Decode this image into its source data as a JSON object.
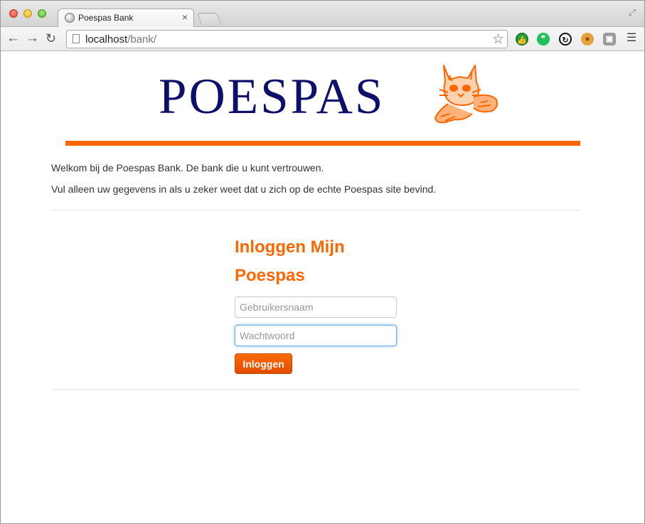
{
  "browser": {
    "tab": {
      "title": "Poespas Bank",
      "close_glyph": "×"
    },
    "url": {
      "host": "localhost",
      "path": "/bank/"
    },
    "icons": [
      "back-icon",
      "forward-icon",
      "reload-icon",
      "page-icon",
      "bookmark-star-icon",
      "fullscreen-icon",
      "menu-icon"
    ],
    "extensions": [
      {
        "name": "thumbs-up-extension-icon",
        "color": "#2aa23a"
      },
      {
        "name": "hangouts-extension-icon",
        "color": "#20c05a"
      },
      {
        "name": "sync-extension-icon",
        "color": "#111111"
      },
      {
        "name": "cookie-extension-icon",
        "color": "#e6a33c"
      },
      {
        "name": "film-extension-icon",
        "color": "#9b9b9b"
      }
    ]
  },
  "page": {
    "logo_text": "POESPAS",
    "logo_color": "#0d0f6a",
    "accent_color": "#ff6600",
    "intro": [
      "Welkom bij de Poespas Bank. De bank die u kunt vertrouwen.",
      "Vul alleen uw gegevens in als u zeker weet dat u zich op de echte Poespas site bevind."
    ],
    "login": {
      "title": "Inloggen Mijn Poespas",
      "username_placeholder": "Gebruikersnaam",
      "password_placeholder": "Wachtwoord",
      "button_label": "Inloggen"
    }
  }
}
